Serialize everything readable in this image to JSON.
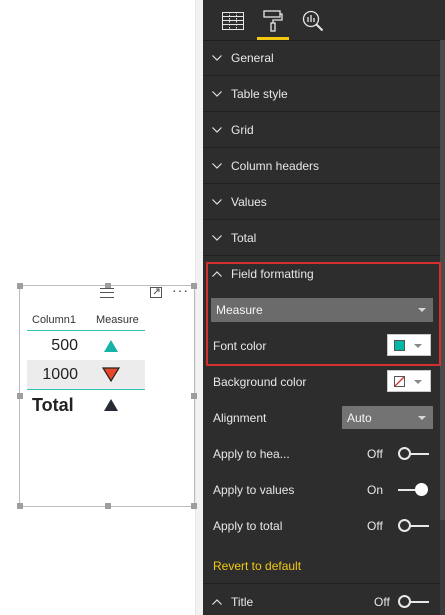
{
  "table_visual": {
    "columns": [
      "Column1",
      "Measure"
    ],
    "rows": [
      {
        "value": "500",
        "indicator": "up-triangle-teal"
      },
      {
        "value": "1000",
        "indicator": "down-triangle-red"
      }
    ],
    "total_label": "Total",
    "total_indicator": "up-triangle-dark"
  },
  "toolbar": {
    "fields_icon": "fields-icon",
    "format_icon": "paint-roller-icon",
    "analytics_icon": "analytics-icon"
  },
  "sections": {
    "general": "General",
    "table_style": "Table style",
    "grid": "Grid",
    "column_headers": "Column headers",
    "values": "Values",
    "total": "Total",
    "field_formatting": "Field formatting",
    "title": "Title"
  },
  "field_formatting": {
    "field_select": "Measure",
    "font_color_label": "Font color",
    "font_color": "#00b7a8",
    "background_color_label": "Background color",
    "alignment_label": "Alignment",
    "alignment_value": "Auto",
    "apply_headers_label": "Apply to hea...",
    "apply_headers_state": "Off",
    "apply_values_label": "Apply to values",
    "apply_values_state": "On",
    "apply_total_label": "Apply to total",
    "apply_total_state": "Off",
    "revert_label": "Revert to default"
  },
  "title_toggle_state": "Off",
  "colors": {
    "accent_yellow": "#f2c811",
    "highlight_red": "#d32f2f",
    "teal": "#2ec5b6",
    "pane_bg": "#2d2d2d"
  }
}
